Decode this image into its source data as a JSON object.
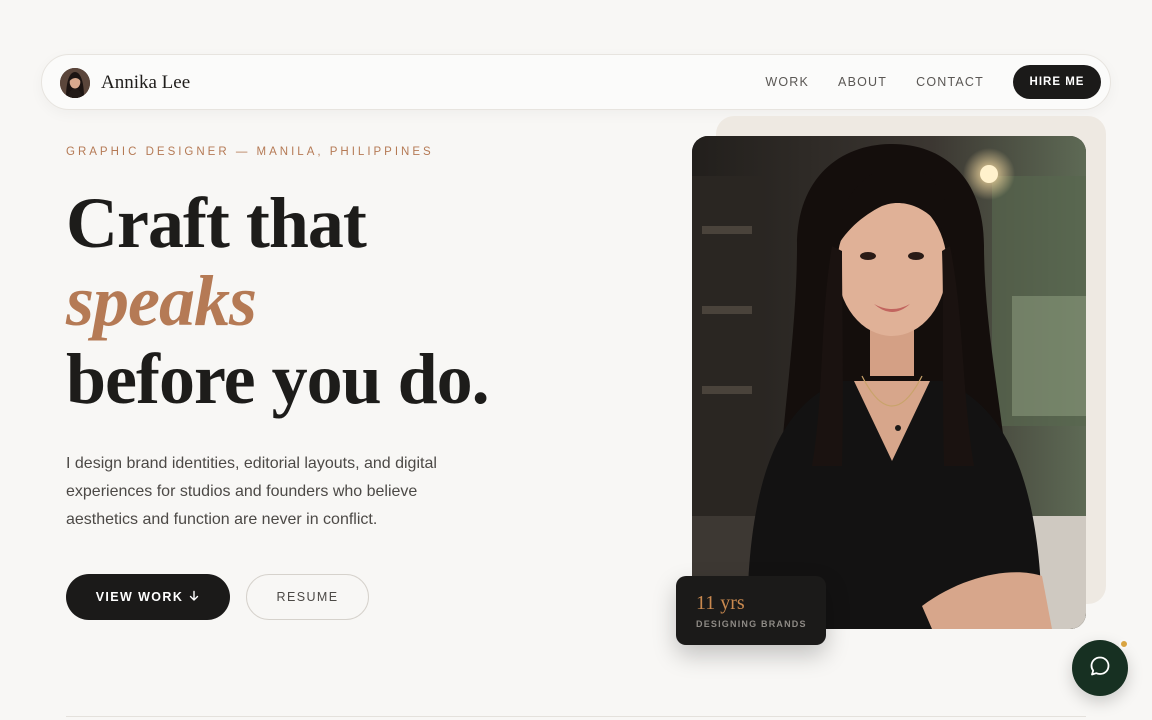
{
  "nav": {
    "brand_name": "Annika Lee",
    "links": [
      "WORK",
      "ABOUT",
      "CONTACT"
    ],
    "cta_label": "HIRE ME"
  },
  "hero": {
    "eyebrow": "GRAPHIC DESIGNER — MANILA, PHILIPPINES",
    "headline_line1": "Craft that",
    "headline_accent": "speaks",
    "headline_line3": "before you do.",
    "intro": "I design brand identities, editorial layouts, and digital experiences for studios and founders who believe aesthetics and function are never in conflict.",
    "primary_button": "VIEW WORK",
    "secondary_button": "RESUME"
  },
  "stat": {
    "value": "11 yrs",
    "label": "DESIGNING BRANDS"
  },
  "icons": {
    "view_work": "arrow-down-icon",
    "chat": "chat-bubble-icon"
  },
  "colors": {
    "accent": "#b57a55",
    "dark": "#1b1a19",
    "chat_button": "#173022",
    "notification_dot": "#d9a441"
  }
}
